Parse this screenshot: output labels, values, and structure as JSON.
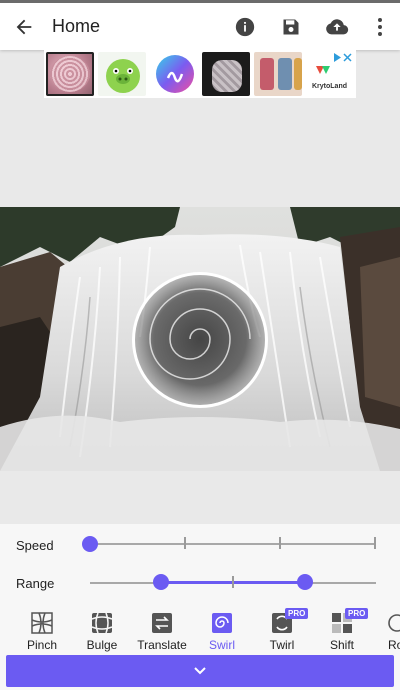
{
  "header": {
    "title": "Home",
    "back_icon": "arrow-left-icon",
    "actions": [
      "info-icon",
      "save-icon",
      "cloud-upload-icon",
      "more-vert-icon"
    ]
  },
  "ad_strip": {
    "thumbnails": [
      "glitter-case",
      "angry-pig-app",
      "musical-ly-app",
      "knit-glove-phone-case",
      "floral-phone-case",
      "krytoland-app"
    ],
    "ad_text": "KrytoLand"
  },
  "controls": {
    "speed_label": "Speed",
    "range_label": "Range",
    "speed_value": 0.0,
    "range_low": 0.25,
    "range_high": 0.75
  },
  "tools": [
    {
      "label": "Pinch",
      "icon": "pinch-icon",
      "pro": false
    },
    {
      "label": "Bulge",
      "icon": "bulge-icon",
      "pro": false
    },
    {
      "label": "Translate",
      "icon": "translate-icon",
      "pro": false
    },
    {
      "label": "Swirl",
      "icon": "swirl-icon",
      "pro": false,
      "active": true
    },
    {
      "label": "Twirl",
      "icon": "twirl-icon",
      "pro": true
    },
    {
      "label": "Shift",
      "icon": "shift-icon",
      "pro": true
    },
    {
      "label": "Ro",
      "icon": "rotate-icon",
      "pro": false
    }
  ],
  "pro_badge": "PRO",
  "colors": {
    "accent": "#6b5bf2",
    "topbar": "#ffffff",
    "background": "#e9e9e9"
  },
  "bottom_button_icon": "chevron-down-icon"
}
